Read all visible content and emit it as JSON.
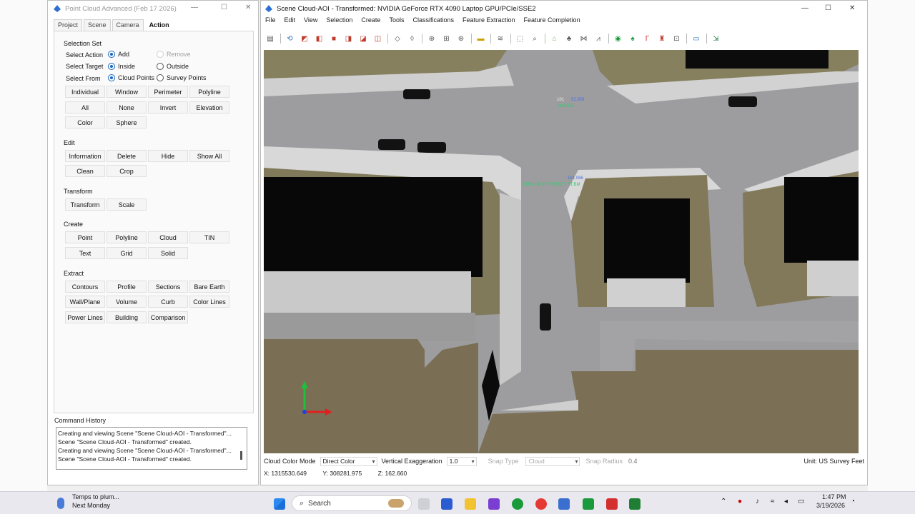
{
  "tool_window": {
    "title": "Point Cloud Advanced (Feb 17 2026)",
    "tabs": [
      "Project",
      "Scene",
      "Camera",
      "Action"
    ],
    "active_tab": "Action",
    "selection_set": {
      "heading": "Selection Set",
      "select_action_label": "Select Action",
      "opt_add": "Add",
      "opt_remove": "Remove",
      "select_target_label": "Select Target",
      "opt_inside": "Inside",
      "opt_outside": "Outside",
      "select_from_label": "Select From",
      "opt_cloud_points": "Cloud Points",
      "opt_survey_points": "Survey Points",
      "buttons": [
        "Individual",
        "Window",
        "Perimeter",
        "Polyline",
        "All",
        "None",
        "Invert",
        "Elevation",
        "Color",
        "Sphere"
      ]
    },
    "edit": {
      "heading": "Edit",
      "buttons": [
        "Information",
        "Delete",
        "Hide",
        "Show All",
        "Clean",
        "Crop"
      ]
    },
    "transform": {
      "heading": "Transform",
      "buttons": [
        "Transform",
        "Scale"
      ]
    },
    "create": {
      "heading": "Create",
      "buttons": [
        "Point",
        "Polyline",
        "Cloud",
        "TIN",
        "Text",
        "Grid",
        "Solid"
      ]
    },
    "extract": {
      "heading": "Extract",
      "buttons": [
        "Contours",
        "Profile",
        "Sections",
        "Bare Earth",
        "Wall/Plane",
        "Volume",
        "Curb",
        "Color Lines",
        "Power Lines",
        "Building",
        "Comparison"
      ]
    },
    "command_history": {
      "label": "Command History",
      "lines": [
        "Creating and viewing Scene \"Scene Cloud-AOI - Transformed\"...",
        "Scene \"Scene Cloud-AOI - Transformed\" created.",
        "Creating and viewing Scene \"Scene Cloud-AOI - Transformed\"...",
        "Scene \"Scene Cloud-AOI - Transformed\" created."
      ]
    }
  },
  "main_window": {
    "title": "Scene Cloud-AOI - Transformed: NVIDIA GeForce RTX 4090 Laptop GPU/PCIe/SSE2",
    "menu": [
      "File",
      "Edit",
      "View",
      "Selection",
      "Create",
      "Tools",
      "Classifications",
      "Feature Extraction",
      "Feature Completion"
    ],
    "viewport_labels": {
      "point_id": "101",
      "point_elev": "52.956",
      "point_desc": "MH/CEN",
      "point2_elev": "161.086",
      "point2_desc": "STRV PK INTERSECT ST.BM"
    },
    "status": {
      "cloud_color_mode_label": "Cloud Color Mode",
      "cloud_color_mode_value": "Direct Color",
      "vertical_exaggeration_label": "Vertical Exaggeration",
      "vertical_exaggeration_value": "1.0",
      "snap_type_label": "Snap Type",
      "snap_type_value": "Cloud",
      "snap_radius_label": "Snap Radius",
      "snap_radius_value": "0.4",
      "unit_label": "Unit:  US Survey Feet"
    },
    "coords": {
      "x": "X: 1315530.649",
      "y": "Y: 308281.975",
      "z": "Z: 162.660"
    }
  },
  "taskbar": {
    "weather_title": "Temps to plum...",
    "weather_sub": "Next Monday",
    "search_label": "Search",
    "time": "1:47 PM",
    "date": "3/19/2026"
  },
  "colors": {
    "accent": "#1565c0",
    "asphalt": "#9c9c9c",
    "roof": "#0a0a0a",
    "grass": "#8a8060"
  }
}
